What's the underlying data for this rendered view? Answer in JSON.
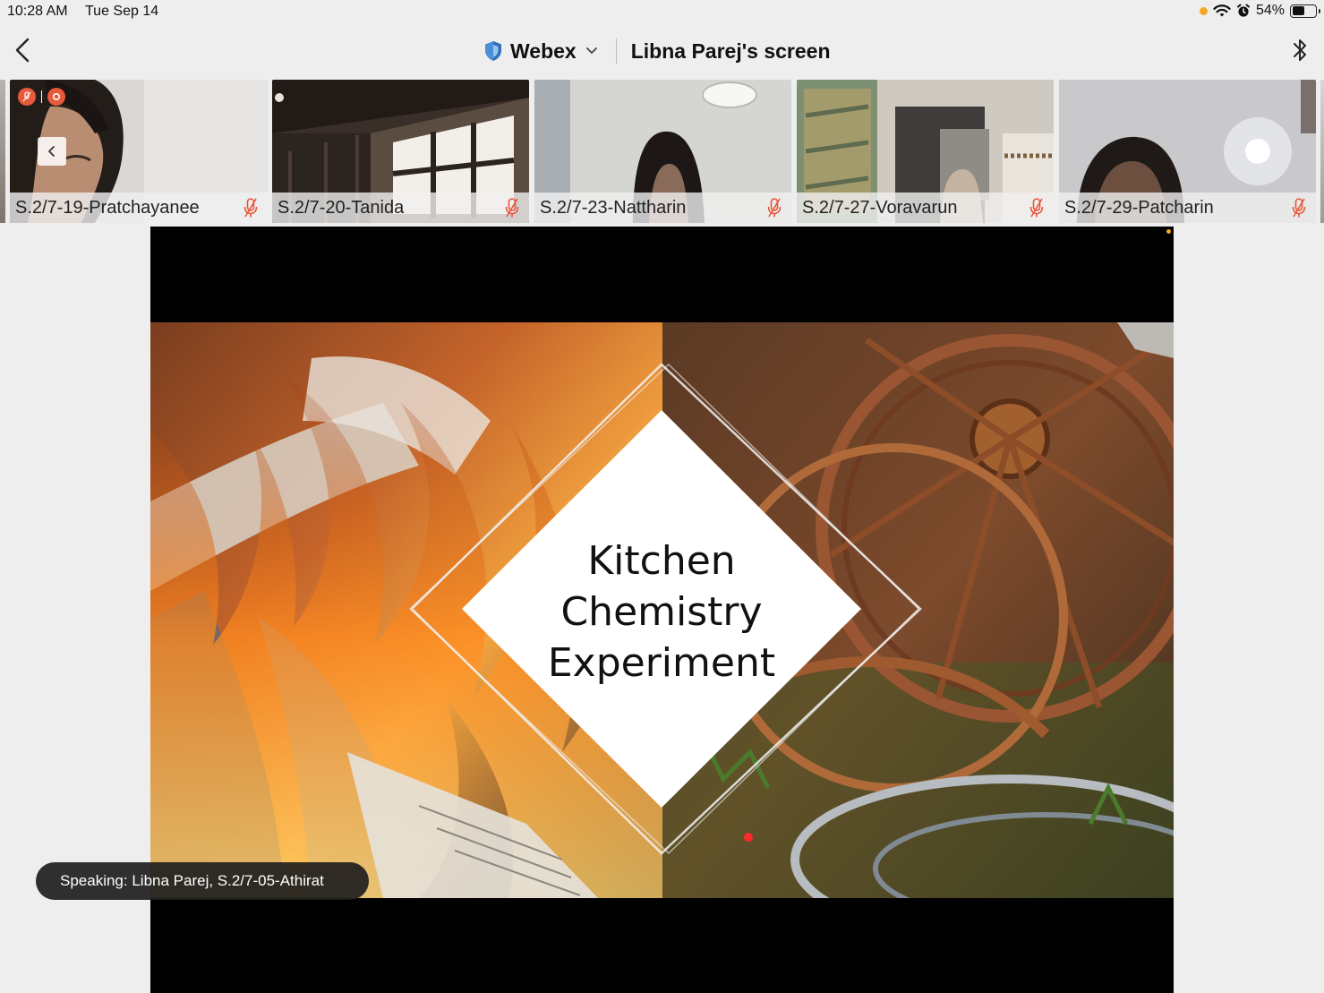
{
  "status_bar": {
    "time": "10:28 AM",
    "date": "Tue Sep 14",
    "battery": "54%",
    "battery_level": 0.54,
    "indicator_color": "#f5a623"
  },
  "nav": {
    "app_name": "Webex",
    "screen_title": "Libna Parej's screen"
  },
  "participants": [
    {
      "name": "S.2/7-19-Pratchayanee",
      "muted": true
    },
    {
      "name": "S.2/7-20-Tanida",
      "muted": true
    },
    {
      "name": "S.2/7-23-Nattharin",
      "muted": true
    },
    {
      "name": "S.2/7-27-Voravarun",
      "muted": true
    },
    {
      "name": "S.2/7-29-Patcharin",
      "muted": true
    }
  ],
  "slide": {
    "title_line1": "Kitchen",
    "title_line2": "Chemistry",
    "title_line3": "Experiment"
  },
  "speaking": {
    "text": "Speaking: Libna Parej, S.2/7-05-Athirat"
  },
  "colors": {
    "accent": "#4a90d9",
    "muted_icon": "#e8553a",
    "recording": "#e85a3c"
  },
  "icons": [
    "back-chevron-icon",
    "shield-icon",
    "chevron-down-icon",
    "bluetooth-icon",
    "wifi-icon",
    "alarm-icon",
    "battery-icon",
    "muted-mic-icon",
    "record-icon"
  ]
}
